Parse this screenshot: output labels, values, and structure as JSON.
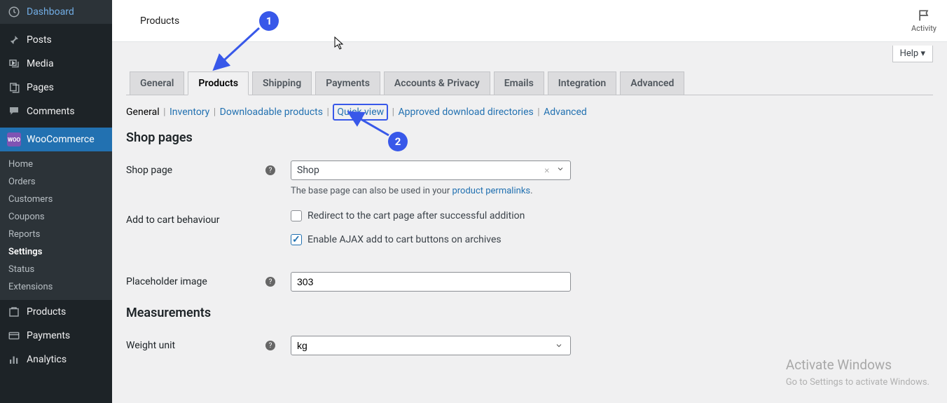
{
  "sidebar": {
    "items": [
      {
        "label": "Dashboard",
        "icon": "dashboard"
      },
      {
        "label": "Posts",
        "icon": "pin"
      },
      {
        "label": "Media",
        "icon": "media"
      },
      {
        "label": "Pages",
        "icon": "pages"
      },
      {
        "label": "Comments",
        "icon": "comments"
      },
      {
        "label": "WooCommerce",
        "icon": "woo",
        "active": true
      },
      {
        "label": "Products",
        "icon": "products"
      },
      {
        "label": "Payments",
        "icon": "payments"
      },
      {
        "label": "Analytics",
        "icon": "analytics"
      }
    ],
    "submenu": [
      "Home",
      "Orders",
      "Customers",
      "Coupons",
      "Reports",
      "Settings",
      "Status",
      "Extensions"
    ],
    "submenu_selected": "Settings"
  },
  "header": {
    "title": "Products",
    "activity": "Activity"
  },
  "help": "Help",
  "tabs": [
    "General",
    "Products",
    "Shipping",
    "Payments",
    "Accounts & Privacy",
    "Emails",
    "Integration",
    "Advanced"
  ],
  "active_tab": "Products",
  "subnav": {
    "current": "General",
    "items": [
      "Inventory",
      "Downloadable products",
      "Quick view",
      "Approved download directories",
      "Advanced"
    ],
    "highlighted": "Quick view"
  },
  "sections": {
    "shop_pages": "Shop pages",
    "measurements": "Measurements"
  },
  "fields": {
    "shop_page_label": "Shop page",
    "shop_page_value": "Shop",
    "shop_page_desc_prefix": "The base page can also be used in your ",
    "shop_page_desc_link": "product permalinks",
    "shop_page_desc_suffix": ".",
    "add_to_cart_label": "Add to cart behaviour",
    "redirect_label": "Redirect to the cart page after successful addition",
    "ajax_label": "Enable AJAX add to cart buttons on archives",
    "placeholder_label": "Placeholder image",
    "placeholder_value": "303",
    "weight_unit_label": "Weight unit",
    "weight_unit_value": "kg"
  },
  "watermark": {
    "title": "Activate Windows",
    "sub": "Go to Settings to activate Windows."
  },
  "annotations": {
    "one": "1",
    "two": "2"
  }
}
